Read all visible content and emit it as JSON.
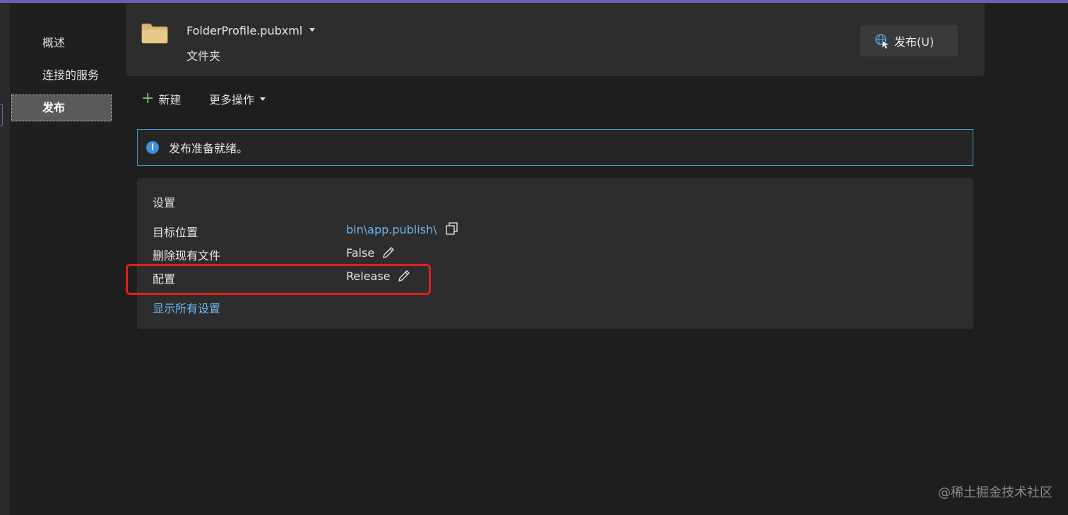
{
  "sidebar": {
    "items": [
      {
        "label": "概述"
      },
      {
        "label": "连接的服务"
      },
      {
        "label": "发布"
      }
    ]
  },
  "header": {
    "profile_name": "FolderProfile.pubxml",
    "profile_type": "文件夹",
    "publish_button": "发布(U)"
  },
  "toolbar": {
    "new_label": "新建",
    "more_actions_label": "更多操作"
  },
  "info_bar": {
    "message": "发布准备就绪。"
  },
  "settings": {
    "title": "设置",
    "rows": [
      {
        "label": "目标位置",
        "value": "bin\\app.publish\\",
        "action_icon": "copy-icon"
      },
      {
        "label": "删除现有文件",
        "value": "False",
        "action_icon": "pencil-icon"
      },
      {
        "label": "配置",
        "value": "Release",
        "action_icon": "pencil-icon"
      }
    ],
    "show_all_label": "显示所有设置"
  },
  "colors": {
    "accent_top": "#6b5fb5",
    "info_border": "#3aa0c8",
    "link": "#6cb6f0",
    "highlight": "#e0201c"
  },
  "watermark": "@稀土掘金技术社区"
}
